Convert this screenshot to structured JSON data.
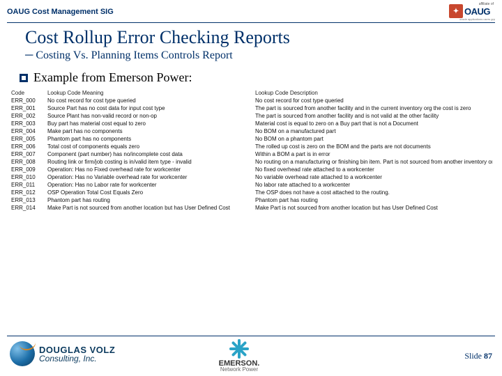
{
  "header": {
    "sig": "OAUG Cost Management SIG",
    "affiliate": "affiliate of",
    "oaug": "OAUG",
    "tagline": "oracle applications users grp"
  },
  "title": "Cost Rollup Error Checking Reports",
  "subtitle": "─ Costing Vs. Planning Items Controls Report",
  "example_lead": "Example from Emerson Power:",
  "cols": {
    "code": "Code",
    "meaning": "Lookup Code Meaning",
    "desc": "Lookup Code Description"
  },
  "rows": [
    {
      "c": "ERR_000",
      "m": "No cost record for cost type queried",
      "d": "No cost record for cost type queried"
    },
    {
      "c": "ERR_001",
      "m": "Source Part has no cost data for input cost type",
      "d": "The part is sourced from another facility and in the current inventory org the cost is zero"
    },
    {
      "c": "ERR_002",
      "m": "Source Plant has non-valid record or non-op",
      "d": "The part is sourced from another facility and is not valid at the other facility"
    },
    {
      "c": "ERR_003",
      "m": "Buy part has material cost equal to zero",
      "d": "Material cost is equal to zero on a Buy part that is not a Document"
    },
    {
      "c": "ERR_004",
      "m": "Make part has no components",
      "d": "No BOM on a manufactured part"
    },
    {
      "c": "ERR_005",
      "m": "Phantom part has no components",
      "d": "No BOM on a phantom part"
    },
    {
      "c": "ERR_006",
      "m": "Total cost of components equals zero",
      "d": "The rolled up cost is zero on the BOM and the parts are not documents"
    },
    {
      "c": "ERR_007",
      "m": "Component (part number) has no/incomplete cost data",
      "d": "Within a BOM a part is in error"
    },
    {
      "c": "ERR_008",
      "m": "Routing link or firm/job costing is in/valid item type - invalid",
      "d": "No routing on a manufacturing or finishing bin item. Part is not sourced from another inventory org"
    },
    {
      "c": "ERR_009",
      "m": "Operation: Has no Fixed overhead rate for workcenter",
      "d": "No fixed overhead rate attached to a workcenter"
    },
    {
      "c": "ERR_010",
      "m": "Operation: Has no Variable overhead rate for workcenter",
      "d": "No variable overhead rate attached to a workcenter"
    },
    {
      "c": "ERR_011",
      "m": "Operation: Has no Labor rate for workcenter",
      "d": "No labor rate attached to a workcenter"
    },
    {
      "c": "ERR_012",
      "m": "OSP Operation Total Cost Equals Zero",
      "d": "The OSP does not have a cost attached to the routing."
    },
    {
      "c": "ERR_013",
      "m": "Phantom part has routing",
      "d": "Phantom part has routing"
    },
    {
      "c": "ERR_014",
      "m": "Make Part is not sourced from another location but has User Defined Cost",
      "d": "Make Part is not sourced from another location but has User Defined Cost"
    }
  ],
  "footer": {
    "douglas1": "DOUGLAS VOLZ",
    "douglas2": "Consulting, Inc.",
    "emerson1": "EMERSON.",
    "emerson2": "Network Power",
    "slide_label": "Slide ",
    "slide_num": "87"
  }
}
